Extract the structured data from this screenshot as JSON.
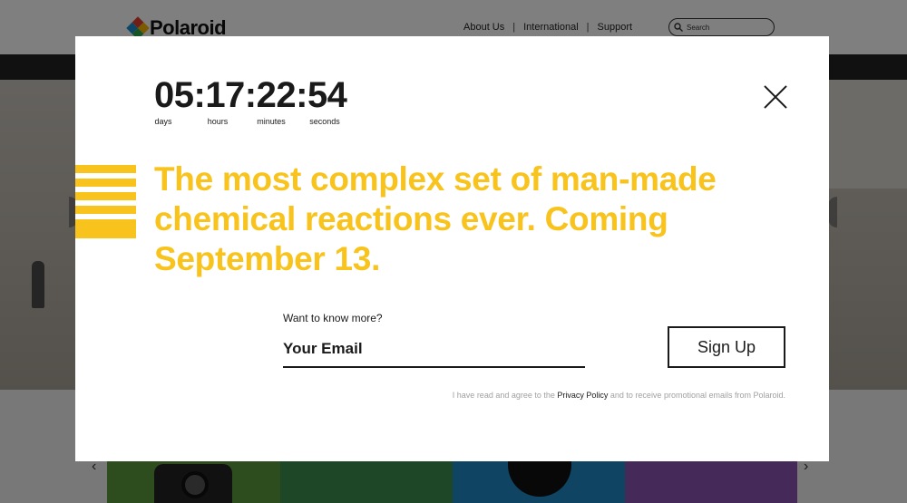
{
  "site": {
    "logo_text": "Polaroid",
    "nav": [
      {
        "label": "About Us"
      },
      {
        "label": "International"
      },
      {
        "label": "Support"
      }
    ],
    "separator": "|",
    "search_placeholder": "Search",
    "carousel_prev": "‹",
    "carousel_next": "›"
  },
  "modal": {
    "countdown": {
      "value": "05:17:22:54",
      "labels": {
        "days": "days",
        "hours": "hours",
        "minutes": "minutes",
        "seconds": "seconds"
      }
    },
    "headline": "The most complex set of man-made chemical reactions ever. Coming September 13.",
    "form": {
      "label": "Want to know more?",
      "email_placeholder": "Your Email",
      "submit_label": "Sign Up"
    },
    "legal": {
      "prefix": "I have read and agree to the ",
      "link_text": "Privacy Policy",
      "suffix": " and to receive promotional emails from Polaroid."
    }
  },
  "colors": {
    "accent_yellow": "#f7c31c",
    "text_dark": "#1a1a1a",
    "overlay": "rgba(0,0,0,0.5)"
  },
  "icons": {
    "close": "close-icon",
    "search": "search-icon",
    "logo_mark": "polaroid-logo-icon",
    "stripes": "yellow-stripes-icon"
  }
}
